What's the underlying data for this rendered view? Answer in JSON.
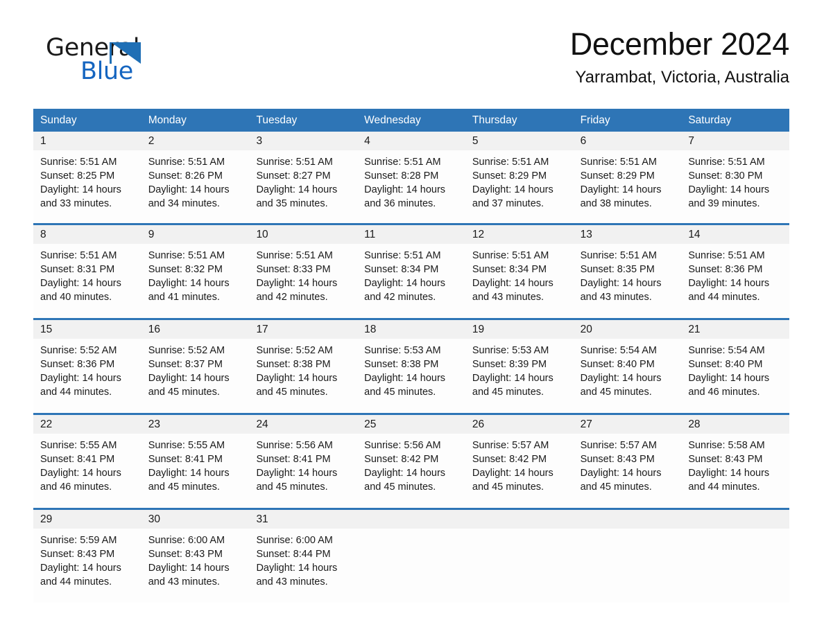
{
  "brand": {
    "name_part1": "General",
    "name_part2": "Blue",
    "accent_color": "#1565c0",
    "triangle_color": "#1f6fb5"
  },
  "header": {
    "month_title": "December 2024",
    "location": "Yarrambat, Victoria, Australia"
  },
  "theme": {
    "header_blue": "#2e75b6",
    "daynum_band": "#f1f1f1",
    "cell_background": "#fdfdfd",
    "text_color": "#1a1a1a"
  },
  "weekdays": [
    "Sunday",
    "Monday",
    "Tuesday",
    "Wednesday",
    "Thursday",
    "Friday",
    "Saturday"
  ],
  "weeks": [
    {
      "days": [
        {
          "num": "1",
          "sunrise": "Sunrise: 5:51 AM",
          "sunset": "Sunset: 8:25 PM",
          "daylight_1": "Daylight: 14 hours",
          "daylight_2": "and 33 minutes."
        },
        {
          "num": "2",
          "sunrise": "Sunrise: 5:51 AM",
          "sunset": "Sunset: 8:26 PM",
          "daylight_1": "Daylight: 14 hours",
          "daylight_2": "and 34 minutes."
        },
        {
          "num": "3",
          "sunrise": "Sunrise: 5:51 AM",
          "sunset": "Sunset: 8:27 PM",
          "daylight_1": "Daylight: 14 hours",
          "daylight_2": "and 35 minutes."
        },
        {
          "num": "4",
          "sunrise": "Sunrise: 5:51 AM",
          "sunset": "Sunset: 8:28 PM",
          "daylight_1": "Daylight: 14 hours",
          "daylight_2": "and 36 minutes."
        },
        {
          "num": "5",
          "sunrise": "Sunrise: 5:51 AM",
          "sunset": "Sunset: 8:29 PM",
          "daylight_1": "Daylight: 14 hours",
          "daylight_2": "and 37 minutes."
        },
        {
          "num": "6",
          "sunrise": "Sunrise: 5:51 AM",
          "sunset": "Sunset: 8:29 PM",
          "daylight_1": "Daylight: 14 hours",
          "daylight_2": "and 38 minutes."
        },
        {
          "num": "7",
          "sunrise": "Sunrise: 5:51 AM",
          "sunset": "Sunset: 8:30 PM",
          "daylight_1": "Daylight: 14 hours",
          "daylight_2": "and 39 minutes."
        }
      ]
    },
    {
      "days": [
        {
          "num": "8",
          "sunrise": "Sunrise: 5:51 AM",
          "sunset": "Sunset: 8:31 PM",
          "daylight_1": "Daylight: 14 hours",
          "daylight_2": "and 40 minutes."
        },
        {
          "num": "9",
          "sunrise": "Sunrise: 5:51 AM",
          "sunset": "Sunset: 8:32 PM",
          "daylight_1": "Daylight: 14 hours",
          "daylight_2": "and 41 minutes."
        },
        {
          "num": "10",
          "sunrise": "Sunrise: 5:51 AM",
          "sunset": "Sunset: 8:33 PM",
          "daylight_1": "Daylight: 14 hours",
          "daylight_2": "and 42 minutes."
        },
        {
          "num": "11",
          "sunrise": "Sunrise: 5:51 AM",
          "sunset": "Sunset: 8:34 PM",
          "daylight_1": "Daylight: 14 hours",
          "daylight_2": "and 42 minutes."
        },
        {
          "num": "12",
          "sunrise": "Sunrise: 5:51 AM",
          "sunset": "Sunset: 8:34 PM",
          "daylight_1": "Daylight: 14 hours",
          "daylight_2": "and 43 minutes."
        },
        {
          "num": "13",
          "sunrise": "Sunrise: 5:51 AM",
          "sunset": "Sunset: 8:35 PM",
          "daylight_1": "Daylight: 14 hours",
          "daylight_2": "and 43 minutes."
        },
        {
          "num": "14",
          "sunrise": "Sunrise: 5:51 AM",
          "sunset": "Sunset: 8:36 PM",
          "daylight_1": "Daylight: 14 hours",
          "daylight_2": "and 44 minutes."
        }
      ]
    },
    {
      "days": [
        {
          "num": "15",
          "sunrise": "Sunrise: 5:52 AM",
          "sunset": "Sunset: 8:36 PM",
          "daylight_1": "Daylight: 14 hours",
          "daylight_2": "and 44 minutes."
        },
        {
          "num": "16",
          "sunrise": "Sunrise: 5:52 AM",
          "sunset": "Sunset: 8:37 PM",
          "daylight_1": "Daylight: 14 hours",
          "daylight_2": "and 45 minutes."
        },
        {
          "num": "17",
          "sunrise": "Sunrise: 5:52 AM",
          "sunset": "Sunset: 8:38 PM",
          "daylight_1": "Daylight: 14 hours",
          "daylight_2": "and 45 minutes."
        },
        {
          "num": "18",
          "sunrise": "Sunrise: 5:53 AM",
          "sunset": "Sunset: 8:38 PM",
          "daylight_1": "Daylight: 14 hours",
          "daylight_2": "and 45 minutes."
        },
        {
          "num": "19",
          "sunrise": "Sunrise: 5:53 AM",
          "sunset": "Sunset: 8:39 PM",
          "daylight_1": "Daylight: 14 hours",
          "daylight_2": "and 45 minutes."
        },
        {
          "num": "20",
          "sunrise": "Sunrise: 5:54 AM",
          "sunset": "Sunset: 8:40 PM",
          "daylight_1": "Daylight: 14 hours",
          "daylight_2": "and 45 minutes."
        },
        {
          "num": "21",
          "sunrise": "Sunrise: 5:54 AM",
          "sunset": "Sunset: 8:40 PM",
          "daylight_1": "Daylight: 14 hours",
          "daylight_2": "and 46 minutes."
        }
      ]
    },
    {
      "days": [
        {
          "num": "22",
          "sunrise": "Sunrise: 5:55 AM",
          "sunset": "Sunset: 8:41 PM",
          "daylight_1": "Daylight: 14 hours",
          "daylight_2": "and 46 minutes."
        },
        {
          "num": "23",
          "sunrise": "Sunrise: 5:55 AM",
          "sunset": "Sunset: 8:41 PM",
          "daylight_1": "Daylight: 14 hours",
          "daylight_2": "and 45 minutes."
        },
        {
          "num": "24",
          "sunrise": "Sunrise: 5:56 AM",
          "sunset": "Sunset: 8:41 PM",
          "daylight_1": "Daylight: 14 hours",
          "daylight_2": "and 45 minutes."
        },
        {
          "num": "25",
          "sunrise": "Sunrise: 5:56 AM",
          "sunset": "Sunset: 8:42 PM",
          "daylight_1": "Daylight: 14 hours",
          "daylight_2": "and 45 minutes."
        },
        {
          "num": "26",
          "sunrise": "Sunrise: 5:57 AM",
          "sunset": "Sunset: 8:42 PM",
          "daylight_1": "Daylight: 14 hours",
          "daylight_2": "and 45 minutes."
        },
        {
          "num": "27",
          "sunrise": "Sunrise: 5:57 AM",
          "sunset": "Sunset: 8:43 PM",
          "daylight_1": "Daylight: 14 hours",
          "daylight_2": "and 45 minutes."
        },
        {
          "num": "28",
          "sunrise": "Sunrise: 5:58 AM",
          "sunset": "Sunset: 8:43 PM",
          "daylight_1": "Daylight: 14 hours",
          "daylight_2": "and 44 minutes."
        }
      ]
    },
    {
      "days": [
        {
          "num": "29",
          "sunrise": "Sunrise: 5:59 AM",
          "sunset": "Sunset: 8:43 PM",
          "daylight_1": "Daylight: 14 hours",
          "daylight_2": "and 44 minutes."
        },
        {
          "num": "30",
          "sunrise": "Sunrise: 6:00 AM",
          "sunset": "Sunset: 8:43 PM",
          "daylight_1": "Daylight: 14 hours",
          "daylight_2": "and 43 minutes."
        },
        {
          "num": "31",
          "sunrise": "Sunrise: 6:00 AM",
          "sunset": "Sunset: 8:44 PM",
          "daylight_1": "Daylight: 14 hours",
          "daylight_2": "and 43 minutes."
        },
        {
          "num": "",
          "sunrise": "",
          "sunset": "",
          "daylight_1": "",
          "daylight_2": ""
        },
        {
          "num": "",
          "sunrise": "",
          "sunset": "",
          "daylight_1": "",
          "daylight_2": ""
        },
        {
          "num": "",
          "sunrise": "",
          "sunset": "",
          "daylight_1": "",
          "daylight_2": ""
        },
        {
          "num": "",
          "sunrise": "",
          "sunset": "",
          "daylight_1": "",
          "daylight_2": ""
        }
      ]
    }
  ]
}
